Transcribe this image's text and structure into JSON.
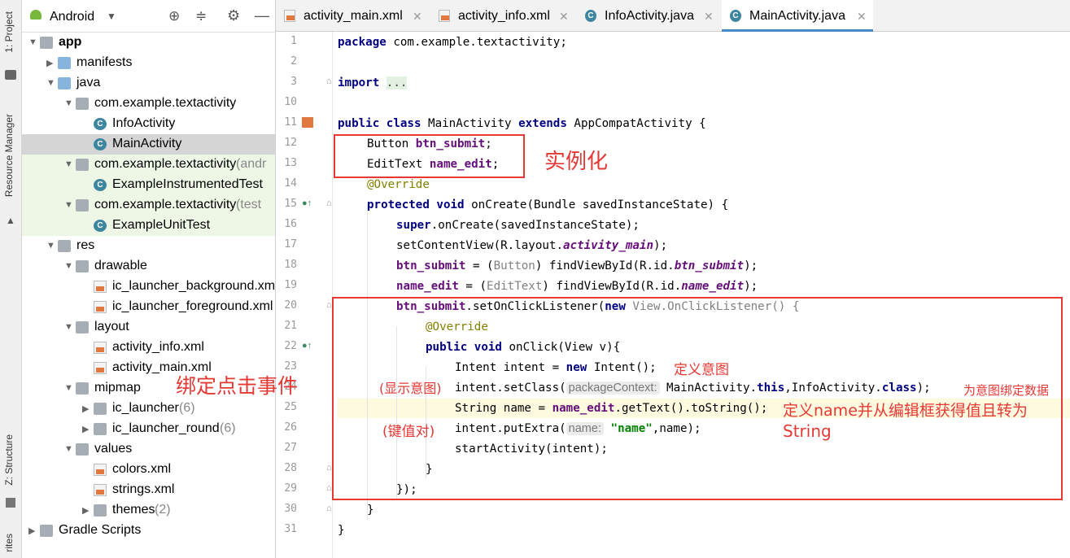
{
  "left_strip": {
    "project": "1: Project",
    "resource_manager": "Resource Manager",
    "structure": "Z: Structure",
    "favorites": "rites"
  },
  "project_header": {
    "view": "Android"
  },
  "tree": [
    {
      "label": "app",
      "bold": true
    },
    {
      "label": "manifests"
    },
    {
      "label": "java"
    },
    {
      "label": "com.example.textactivity"
    },
    {
      "label": "InfoActivity"
    },
    {
      "label": "MainActivity"
    },
    {
      "label": "com.example.textactivity",
      "suffix": " (andr"
    },
    {
      "label": "ExampleInstrumentedTest"
    },
    {
      "label": "com.example.textactivity",
      "suffix": " (test"
    },
    {
      "label": "ExampleUnitTest"
    },
    {
      "label": "res"
    },
    {
      "label": "drawable"
    },
    {
      "label": "ic_launcher_background.xml"
    },
    {
      "label": "ic_launcher_foreground.xml"
    },
    {
      "label": "layout"
    },
    {
      "label": "activity_info.xml"
    },
    {
      "label": "activity_main.xml"
    },
    {
      "label": "mipmap"
    },
    {
      "label": "ic_launcher",
      "suffix": " (6)"
    },
    {
      "label": "ic_launcher_round",
      "suffix": " (6)"
    },
    {
      "label": "values"
    },
    {
      "label": "colors.xml"
    },
    {
      "label": "strings.xml"
    },
    {
      "label": "themes",
      "suffix": " (2)"
    },
    {
      "label": "Gradle Scripts"
    }
  ],
  "tabs": [
    {
      "label": "activity_main.xml"
    },
    {
      "label": "activity_info.xml"
    },
    {
      "label": "InfoActivity.java"
    },
    {
      "label": "MainActivity.java",
      "active": true
    }
  ],
  "line_numbers": [
    "1",
    "2",
    "3",
    "10",
    "11",
    "12",
    "13",
    "14",
    "15",
    "16",
    "17",
    "18",
    "19",
    "20",
    "21",
    "22",
    "23",
    "24",
    "25",
    "26",
    "27",
    "28",
    "29",
    "30",
    "31"
  ],
  "code": {
    "l1_kw": "package",
    "l1_rest": " com.example.textactivity;",
    "l3_kw": "import",
    "l3_dots": "...",
    "l11_a": "public class",
    "l11_b": " MainActivity ",
    "l11_c": "extends",
    "l11_d": " AppCompatActivity {",
    "l12_a": "Button ",
    "l12_b": "btn_submit",
    "l12_c": ";",
    "l13_a": "EditText ",
    "l13_b": "name_edit",
    "l13_c": ";",
    "l14": "@Override",
    "l15_a": "protected void",
    "l15_b": " onCreate(Bundle savedInstanceState) {",
    "l16_a": "super",
    "l16_b": ".onCreate(savedInstanceState);",
    "l17_a": "setContentView(R.layout.",
    "l17_b": "activity_main",
    "l17_c": ");",
    "l18_a": "btn_submit",
    "l18_b": " = (",
    "l18_c": "Button",
    "l18_d": ") findViewById(R.id.",
    "l18_e": "btn_submit",
    "l18_f": ");",
    "l19_a": "name_edit",
    "l19_b": " = (",
    "l19_c": "EditText",
    "l19_d": ") findViewById(R.id.",
    "l19_e": "name_edit",
    "l19_f": ");",
    "l20_a": "btn_submit",
    "l20_b": ".setOnClickListener(",
    "l20_c": "new",
    "l20_d": " View.OnClickListener() {",
    "l21": "@Override",
    "l22_a": "public void",
    "l22_b": " onClick(View v){",
    "l23_a": "Intent intent = ",
    "l23_b": "new",
    "l23_c": " Intent();",
    "l24_a": "intent.setClass(",
    "l24_hint": "packageContext:",
    "l24_b": " MainActivity.",
    "l24_c": "this",
    "l24_d": ",InfoActivity.",
    "l24_e": "class",
    "l24_f": ");",
    "l25_a": "String name = ",
    "l25_b": "name_edit",
    "l25_c": ".getText().toString();",
    "l26_a": "intent.putExtra(",
    "l26_hint": "name:",
    "l26_b": " \"name\"",
    "l26_c": ",name);",
    "l27": "startActivity(intent);",
    "l28": "}",
    "l29": "});",
    "l30": "}",
    "l31": "}"
  },
  "annotations": {
    "instantiate": "实例化",
    "bind_click": "绑定点击事件",
    "define_intent": "定义意图",
    "explicit_intent": "(显示意图)",
    "bind_data": "为意图绑定数据",
    "define_name": "定义name并从编辑框获得值且转为",
    "string_word": "String",
    "key_value": "(键值对)"
  },
  "colors": {
    "accent": "#e53935",
    "keyword": "#000080",
    "field": "#660e7a",
    "annotation": "#808000",
    "string": "#008000"
  }
}
